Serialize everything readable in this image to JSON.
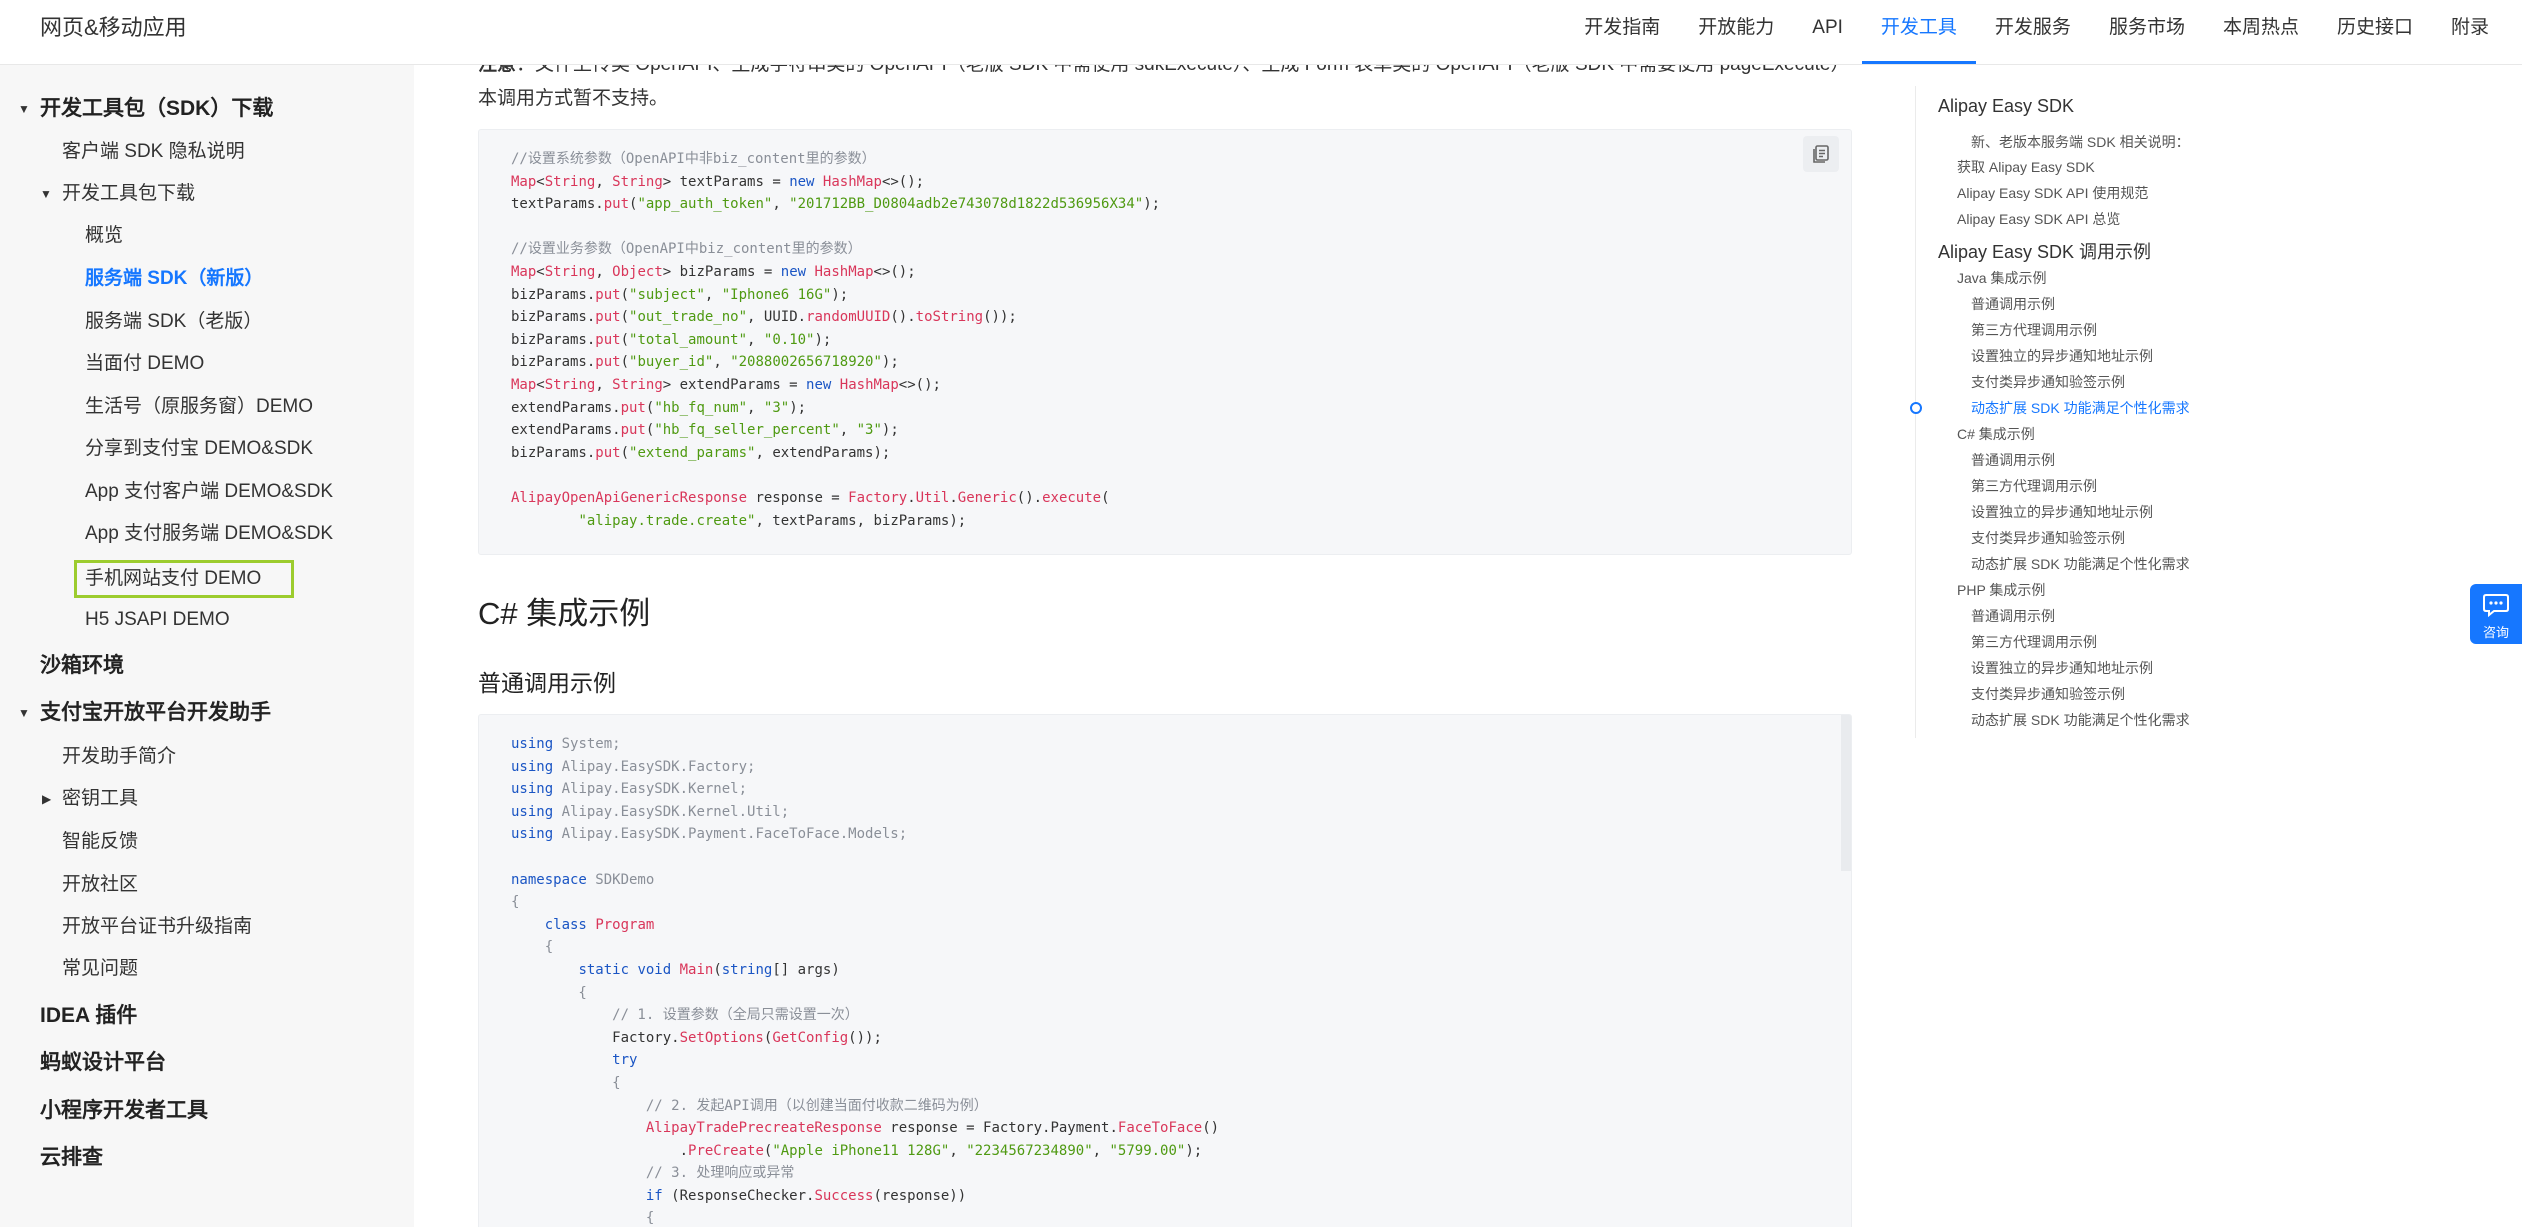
{
  "header": {
    "brand": "网页&移动应用",
    "nav": [
      "开发指南",
      "开放能力",
      "API",
      "开发工具",
      "开发服务",
      "服务市场",
      "本周热点",
      "历史接口",
      "附录"
    ],
    "active_nav": "开发工具"
  },
  "sidebar": {
    "items": [
      {
        "label": "开发工具包（SDK）下载",
        "level": 0,
        "arrow": "down"
      },
      {
        "label": "客户端 SDK 隐私说明",
        "level": 1
      },
      {
        "label": "开发工具包下载",
        "level": 1,
        "arrow": "down"
      },
      {
        "label": "概览",
        "level": 2
      },
      {
        "label": "服务端 SDK（新版）",
        "level": 2,
        "active": true
      },
      {
        "label": "服务端 SDK（老版）",
        "level": 2
      },
      {
        "label": "当面付 DEMO",
        "level": 2
      },
      {
        "label": "生活号（原服务窗）DEMO",
        "level": 2
      },
      {
        "label": "分享到支付宝 DEMO&SDK",
        "level": 2
      },
      {
        "label": "App 支付客户端 DEMO&SDK",
        "level": 2
      },
      {
        "label": "App 支付服务端 DEMO&SDK",
        "level": 2
      },
      {
        "label": "手机网站支付 DEMO",
        "level": 2,
        "outlined": true
      },
      {
        "label": "H5 JSAPI DEMO",
        "level": 2
      },
      {
        "label": "沙箱环境",
        "level": 0
      },
      {
        "label": "支付宝开放平台开发助手",
        "level": 0,
        "arrow": "down"
      },
      {
        "label": "开发助手简介",
        "level": 1
      },
      {
        "label": "密钥工具",
        "level": 1,
        "arrow": "right"
      },
      {
        "label": "智能反馈",
        "level": 1
      },
      {
        "label": "开放社区",
        "level": 1
      },
      {
        "label": "开放平台证书升级指南",
        "level": 1
      },
      {
        "label": "常见问题",
        "level": 1
      },
      {
        "label": "IDEA 插件",
        "level": 0
      },
      {
        "label": "蚂蚁设计平台",
        "level": 0
      },
      {
        "label": "小程序开发者工具",
        "level": 0
      },
      {
        "label": "云排查",
        "level": 0
      }
    ]
  },
  "content": {
    "intro_bold": "注意",
    "intro_text": "：文件上传类 OpenAPI、生成字符串类的 OpenAPI（老版 SDK 中需使用 sdkExecute）、生成 Form 表单类的 OpenAPI（老版 SDK 中需要使用 pageExecute）本调用方式暂不支持。",
    "h_csharp": "C# 集成示例",
    "h_normal": "普通调用示例",
    "copy_icon": "copy-icon"
  },
  "code_java": [
    [
      [
        "c-cm",
        "//设置系统参数（OpenAPI中非biz_content里的参数）"
      ]
    ],
    [
      [
        "c-ty",
        "Map"
      ],
      [
        "c-pl",
        "<"
      ],
      [
        "c-ty",
        "String"
      ],
      [
        "c-pl",
        ", "
      ],
      [
        "c-ty",
        "String"
      ],
      [
        "c-pl",
        "> textParams = "
      ],
      [
        "c-kw",
        "new"
      ],
      [
        "c-pl",
        " "
      ],
      [
        "c-ty",
        "HashMap"
      ],
      [
        "c-pl",
        "<>();"
      ]
    ],
    [
      [
        "c-pl",
        "textParams."
      ],
      [
        "c-ty",
        "put"
      ],
      [
        "c-pl",
        "("
      ],
      [
        "c-st",
        "\"app_auth_token\""
      ],
      [
        "c-pl",
        ", "
      ],
      [
        "c-st",
        "\"201712BB_D0804adb2e743078d1822d536956X34\""
      ],
      [
        "c-pl",
        ");"
      ]
    ],
    [
      [
        "c-pl",
        ""
      ]
    ],
    [
      [
        "c-cm",
        "//设置业务参数（OpenAPI中biz_content里的参数）"
      ]
    ],
    [
      [
        "c-ty",
        "Map"
      ],
      [
        "c-pl",
        "<"
      ],
      [
        "c-ty",
        "String"
      ],
      [
        "c-pl",
        ", "
      ],
      [
        "c-ty",
        "Object"
      ],
      [
        "c-pl",
        "> bizParams = "
      ],
      [
        "c-kw",
        "new"
      ],
      [
        "c-pl",
        " "
      ],
      [
        "c-ty",
        "HashMap"
      ],
      [
        "c-pl",
        "<>();"
      ]
    ],
    [
      [
        "c-pl",
        "bizParams."
      ],
      [
        "c-ty",
        "put"
      ],
      [
        "c-pl",
        "("
      ],
      [
        "c-st",
        "\"subject\""
      ],
      [
        "c-pl",
        ", "
      ],
      [
        "c-st",
        "\"Iphone6 16G\""
      ],
      [
        "c-pl",
        ");"
      ]
    ],
    [
      [
        "c-pl",
        "bizParams."
      ],
      [
        "c-ty",
        "put"
      ],
      [
        "c-pl",
        "("
      ],
      [
        "c-st",
        "\"out_trade_no\""
      ],
      [
        "c-pl",
        ", UUID."
      ],
      [
        "c-ty",
        "randomUUID"
      ],
      [
        "c-pl",
        "()."
      ],
      [
        "c-ty",
        "toString"
      ],
      [
        "c-pl",
        "());"
      ]
    ],
    [
      [
        "c-pl",
        "bizParams."
      ],
      [
        "c-ty",
        "put"
      ],
      [
        "c-pl",
        "("
      ],
      [
        "c-st",
        "\"total_amount\""
      ],
      [
        "c-pl",
        ", "
      ],
      [
        "c-st",
        "\"0.10\""
      ],
      [
        "c-pl",
        ");"
      ]
    ],
    [
      [
        "c-pl",
        "bizParams."
      ],
      [
        "c-ty",
        "put"
      ],
      [
        "c-pl",
        "("
      ],
      [
        "c-st",
        "\"buyer_id\""
      ],
      [
        "c-pl",
        ", "
      ],
      [
        "c-st",
        "\"2088002656718920\""
      ],
      [
        "c-pl",
        ");"
      ]
    ],
    [
      [
        "c-ty",
        "Map"
      ],
      [
        "c-pl",
        "<"
      ],
      [
        "c-ty",
        "String"
      ],
      [
        "c-pl",
        ", "
      ],
      [
        "c-ty",
        "String"
      ],
      [
        "c-pl",
        "> extendParams = "
      ],
      [
        "c-kw",
        "new"
      ],
      [
        "c-pl",
        " "
      ],
      [
        "c-ty",
        "HashMap"
      ],
      [
        "c-pl",
        "<>();"
      ]
    ],
    [
      [
        "c-pl",
        "extendParams."
      ],
      [
        "c-ty",
        "put"
      ],
      [
        "c-pl",
        "("
      ],
      [
        "c-st",
        "\"hb_fq_num\""
      ],
      [
        "c-pl",
        ", "
      ],
      [
        "c-st",
        "\"3\""
      ],
      [
        "c-pl",
        ");"
      ]
    ],
    [
      [
        "c-pl",
        "extendParams."
      ],
      [
        "c-ty",
        "put"
      ],
      [
        "c-pl",
        "("
      ],
      [
        "c-st",
        "\"hb_fq_seller_percent\""
      ],
      [
        "c-pl",
        ", "
      ],
      [
        "c-st",
        "\"3\""
      ],
      [
        "c-pl",
        ");"
      ]
    ],
    [
      [
        "c-pl",
        "bizParams."
      ],
      [
        "c-ty",
        "put"
      ],
      [
        "c-pl",
        "("
      ],
      [
        "c-st",
        "\"extend_params\""
      ],
      [
        "c-pl",
        ", extendParams);"
      ]
    ],
    [
      [
        "c-pl",
        ""
      ]
    ],
    [
      [
        "c-ty",
        "AlipayOpenApiGenericResponse"
      ],
      [
        "c-pl",
        " response = "
      ],
      [
        "c-ty",
        "Factory"
      ],
      [
        "c-pl",
        "."
      ],
      [
        "c-ty",
        "Util"
      ],
      [
        "c-pl",
        "."
      ],
      [
        "c-ty",
        "Generic"
      ],
      [
        "c-pl",
        "()."
      ],
      [
        "c-ty",
        "execute"
      ],
      [
        "c-pl",
        "("
      ]
    ],
    [
      [
        "c-pl",
        "        "
      ],
      [
        "c-st",
        "\"alipay.trade.create\""
      ],
      [
        "c-pl",
        ", textParams, bizParams);"
      ]
    ]
  ],
  "code_csharp": [
    [
      [
        "c-kw",
        "using"
      ],
      [
        "c-gr",
        " System;"
      ]
    ],
    [
      [
        "c-kw",
        "using"
      ],
      [
        "c-gr",
        " Alipay.EasySDK.Factory;"
      ]
    ],
    [
      [
        "c-kw",
        "using"
      ],
      [
        "c-gr",
        " Alipay.EasySDK.Kernel;"
      ]
    ],
    [
      [
        "c-kw",
        "using"
      ],
      [
        "c-gr",
        " Alipay.EasySDK.Kernel.Util;"
      ]
    ],
    [
      [
        "c-kw",
        "using"
      ],
      [
        "c-gr",
        " Alipay.EasySDK.Payment.FaceToFace.Models;"
      ]
    ],
    [
      [
        "c-pl",
        ""
      ]
    ],
    [
      [
        "c-kw",
        "namespace"
      ],
      [
        "c-gr",
        " SDKDemo"
      ]
    ],
    [
      [
        "c-gr",
        "{"
      ]
    ],
    [
      [
        "c-pl",
        "    "
      ],
      [
        "c-kw",
        "class"
      ],
      [
        "c-pl",
        " "
      ],
      [
        "c-ty",
        "Program"
      ]
    ],
    [
      [
        "c-gr",
        "    {"
      ]
    ],
    [
      [
        "c-pl",
        "        "
      ],
      [
        "c-kw",
        "static void"
      ],
      [
        "c-pl",
        " "
      ],
      [
        "c-ty",
        "Main"
      ],
      [
        "c-pl",
        "("
      ],
      [
        "c-kw",
        "string"
      ],
      [
        "c-pl",
        "[] args)"
      ]
    ],
    [
      [
        "c-gr",
        "        {"
      ]
    ],
    [
      [
        "c-cm",
        "            // 1. 设置参数（全局只需设置一次）"
      ]
    ],
    [
      [
        "c-pl",
        "            Factory."
      ],
      [
        "c-ty",
        "SetOptions"
      ],
      [
        "c-pl",
        "("
      ],
      [
        "c-ty",
        "GetConfig"
      ],
      [
        "c-pl",
        "());"
      ]
    ],
    [
      [
        "c-kw",
        "            try"
      ]
    ],
    [
      [
        "c-gr",
        "            {"
      ]
    ],
    [
      [
        "c-cm",
        "                // 2. 发起API调用（以创建当面付收款二维码为例）"
      ]
    ],
    [
      [
        "c-ty",
        "                AlipayTradePrecreateResponse"
      ],
      [
        "c-pl",
        " response = Factory.Payment."
      ],
      [
        "c-ty",
        "FaceToFace"
      ],
      [
        "c-pl",
        "()"
      ]
    ],
    [
      [
        "c-pl",
        "                    ."
      ],
      [
        "c-ty",
        "PreCreate"
      ],
      [
        "c-pl",
        "("
      ],
      [
        "c-st",
        "\"Apple iPhone11 128G\""
      ],
      [
        "c-pl",
        ", "
      ],
      [
        "c-st",
        "\"2234567234890\""
      ],
      [
        "c-pl",
        ", "
      ],
      [
        "c-st",
        "\"5799.00\""
      ],
      [
        "c-pl",
        ");"
      ]
    ],
    [
      [
        "c-cm",
        "                // 3. 处理响应或异常"
      ]
    ],
    [
      [
        "c-kw",
        "                if"
      ],
      [
        "c-pl",
        " (ResponseChecker."
      ],
      [
        "c-ty",
        "Success"
      ],
      [
        "c-pl",
        "(response))"
      ]
    ],
    [
      [
        "c-gr",
        "                {"
      ]
    ]
  ],
  "toc": {
    "items": [
      {
        "label": "Alipay Easy SDK",
        "level": 1
      },
      {
        "label": "新、老版本服务端 SDK 相关说明：",
        "level": 3
      },
      {
        "label": "获取 Alipay Easy SDK",
        "level": 2
      },
      {
        "label": "Alipay Easy SDK API 使用规范",
        "level": 2
      },
      {
        "label": "Alipay Easy SDK API 总览",
        "level": 2
      },
      {
        "label": "Alipay Easy SDK 调用示例",
        "level": 1
      },
      {
        "label": "Java 集成示例",
        "level": 2
      },
      {
        "label": "普通调用示例",
        "level": 3
      },
      {
        "label": "第三方代理调用示例",
        "level": 3
      },
      {
        "label": "设置独立的异步通知地址示例",
        "level": 3
      },
      {
        "label": "支付类异步通知验签示例",
        "level": 3
      },
      {
        "label": "动态扩展 SDK 功能满足个性化需求",
        "level": 3,
        "active": true
      },
      {
        "label": "C# 集成示例",
        "level": 2
      },
      {
        "label": "普通调用示例",
        "level": 3
      },
      {
        "label": "第三方代理调用示例",
        "level": 3
      },
      {
        "label": "设置独立的异步通知地址示例",
        "level": 3
      },
      {
        "label": "支付类异步通知验签示例",
        "level": 3
      },
      {
        "label": "动态扩展 SDK 功能满足个性化需求",
        "level": 3
      },
      {
        "label": "PHP 集成示例",
        "level": 2
      },
      {
        "label": "普通调用示例",
        "level": 3
      },
      {
        "label": "第三方代理调用示例",
        "level": 3
      },
      {
        "label": "设置独立的异步通知地址示例",
        "level": 3
      },
      {
        "label": "支付类异步通知验签示例",
        "level": 3
      },
      {
        "label": "动态扩展 SDK 功能满足个性化需求",
        "level": 3
      }
    ]
  },
  "consult": {
    "label": "咨询",
    "icon": "chat-bubble-icon"
  },
  "colors": {
    "accent": "#1677ff",
    "highlight_outline": "#9ccc2e"
  }
}
